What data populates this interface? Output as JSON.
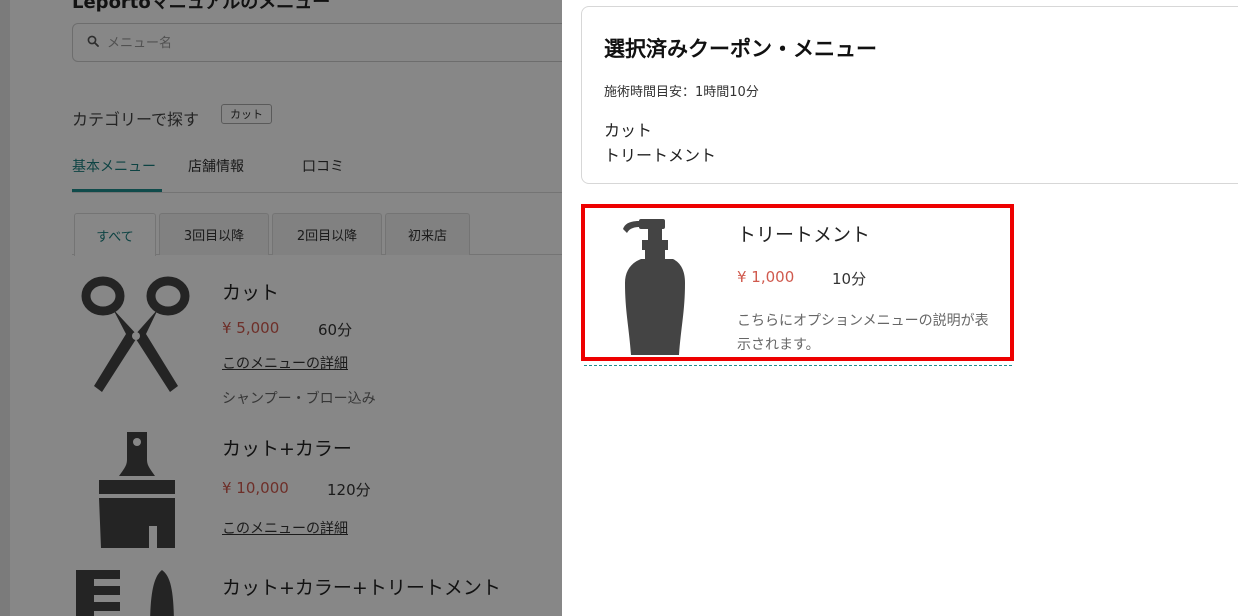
{
  "background": {
    "page_title": "Leportoマニュアルのメニュー",
    "search": {
      "placeholder": "メニュー名",
      "value": ""
    },
    "category": {
      "label": "カテゴリーで探す",
      "chip": "カット"
    },
    "tabs": [
      {
        "label": "基本メニュー",
        "active": true
      },
      {
        "label": "店舗情報",
        "active": false
      },
      {
        "label": "口コミ",
        "active": false
      }
    ],
    "subtabs": [
      {
        "label": "すべて",
        "active": true
      },
      {
        "label": "3回目以降",
        "active": false
      },
      {
        "label": "2回目以降",
        "active": false
      },
      {
        "label": "初来店",
        "active": false
      }
    ],
    "menu_items": [
      {
        "icon": "scissors-icon",
        "name": "カット",
        "price": "¥ 5,000",
        "time": "60分",
        "detail_link": "このメニューの詳細",
        "note": "シャンプー・ブロー込み"
      },
      {
        "icon": "brush-icon",
        "name": "カット+カラー",
        "price": "¥ 10,000",
        "time": "120分",
        "detail_link": "このメニューの詳細",
        "note": ""
      },
      {
        "icon": "comb-icon",
        "name": "カット+カラー+トリートメント",
        "price": "",
        "time": "",
        "detail_link": "",
        "note": ""
      }
    ]
  },
  "drawer": {
    "summary": {
      "title": "選択済みクーポン・メニュー",
      "time_label": "施術時間目安：1時間10分",
      "items": [
        "カット",
        "トリートメント"
      ]
    },
    "option": {
      "icon": "pump-bottle-icon",
      "name": "トリートメント",
      "price": "¥ 1,000",
      "time": "10分",
      "description": "こちらにオプションメニューの説明が表示されます。"
    }
  },
  "colors": {
    "accent": "#1f8f8f",
    "price": "#d05a4e",
    "highlight": "#ee0000",
    "icon": "#444444",
    "overlay": "rgba(0,0,0,0.47)"
  }
}
